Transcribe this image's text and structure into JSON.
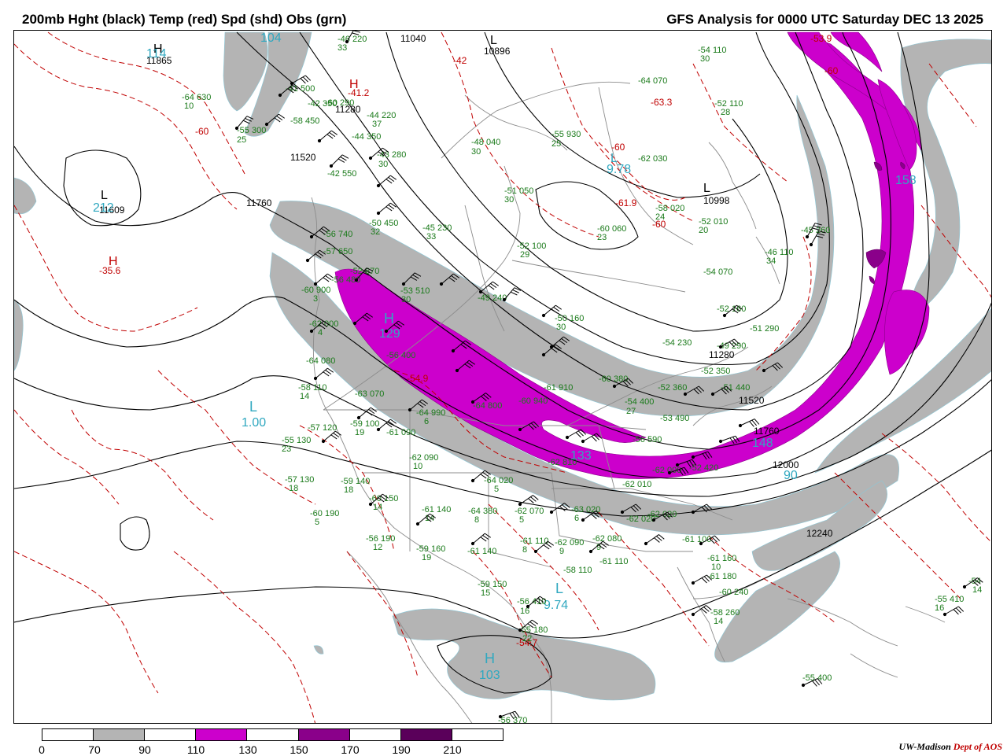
{
  "header": {
    "title_left": "200mb Hght (black) Temp (red) Spd (shd) Obs (grn)",
    "title_right": "GFS Analysis for 0000 UTC Saturday  DEC 13 2025"
  },
  "colors": {
    "height_contour": "#000000",
    "temp_contour": "#c00000",
    "obs_text": "#1a7a1a",
    "speed_label": "#30a8c0",
    "geography": "#8c8c8c",
    "speed_70_90": "#b4b4b4",
    "speed_110_130": "#cc00cc",
    "speed_150_170": "#8a008a",
    "speed_190_210": "#5a005a"
  },
  "colorbar": {
    "labels": [
      "0",
      "70",
      "90",
      "110",
      "130",
      "150",
      "170",
      "190",
      "210"
    ],
    "segments": [
      "#ffffff",
      "#b4b4b4",
      "#ffffff",
      "#cc00cc",
      "#ffffff",
      "#8a008a",
      "#ffffff",
      "#5a005a",
      "#ffffff"
    ]
  },
  "credit": {
    "org": "UW-Madison",
    "dept": "Dept of AOS"
  },
  "height_labels": [
    {
      "text": "11040"
    },
    {
      "text": "10896"
    },
    {
      "text": "11280"
    },
    {
      "text": "11520"
    },
    {
      "text": "11760"
    },
    {
      "text": "11609"
    },
    {
      "text": "11865"
    },
    {
      "text": "10998"
    },
    {
      "text": "11520"
    },
    {
      "text": "11760"
    },
    {
      "text": "12000"
    },
    {
      "text": "12240"
    },
    {
      "text": "11280"
    }
  ],
  "temp_labels": [
    {
      "text": "-41.2"
    },
    {
      "text": "-42"
    },
    {
      "text": "-60"
    },
    {
      "text": "-35.6"
    },
    {
      "text": "-54.9"
    },
    {
      "text": "-61.9"
    },
    {
      "text": "-63.3"
    },
    {
      "text": "-60"
    },
    {
      "text": "-54.7"
    },
    {
      "text": "-53.9"
    },
    {
      "text": "-60"
    },
    {
      "text": "-60"
    }
  ],
  "hl_markers": [
    {
      "text": "H"
    },
    {
      "text": "L"
    },
    {
      "text": "H"
    },
    {
      "text": "H"
    },
    {
      "text": "L"
    },
    {
      "text": "L"
    },
    {
      "text": "H"
    },
    {
      "text": "L"
    },
    {
      "text": "L"
    },
    {
      "text": "L"
    },
    {
      "text": "H"
    }
  ],
  "speed_labels": [
    {
      "text": "104"
    },
    {
      "text": "114"
    },
    {
      "text": "129"
    },
    {
      "text": "1.00"
    },
    {
      "text": "9.78"
    },
    {
      "text": "158"
    },
    {
      "text": "133"
    },
    {
      "text": "148"
    },
    {
      "text": "90"
    },
    {
      "text": "9.74"
    },
    {
      "text": "103"
    },
    {
      "text": "212"
    }
  ],
  "obs": [
    {
      "text": "-46 220"
    },
    {
      "text": "33"
    },
    {
      "text": "-64 630"
    },
    {
      "text": "10"
    },
    {
      "text": "-55 300"
    },
    {
      "text": "25"
    },
    {
      "text": "-42 350"
    },
    {
      "text": "-44 220"
    },
    {
      "text": "37"
    },
    {
      "text": "-41 500"
    },
    {
      "text": "-48 040"
    },
    {
      "text": "30"
    },
    {
      "text": "-55 930"
    },
    {
      "text": "25"
    },
    {
      "text": "-64 070"
    },
    {
      "text": "-54 110"
    },
    {
      "text": "30"
    },
    {
      "text": "-52 110"
    },
    {
      "text": "28"
    },
    {
      "text": "-62 030"
    },
    {
      "text": "-52 010"
    },
    {
      "text": "20"
    },
    {
      "text": "-58 020"
    },
    {
      "text": "24"
    },
    {
      "text": "-60 060"
    },
    {
      "text": "23"
    },
    {
      "text": "-51 050"
    },
    {
      "text": "30"
    },
    {
      "text": "-52 100"
    },
    {
      "text": "29"
    },
    {
      "text": "-45 230"
    },
    {
      "text": "33"
    },
    {
      "text": "-50 450"
    },
    {
      "text": "32"
    },
    {
      "text": "-43 280"
    },
    {
      "text": "30"
    },
    {
      "text": "-52 670"
    },
    {
      "text": "-53 510"
    },
    {
      "text": "30"
    },
    {
      "text": "-49 240"
    },
    {
      "text": "-50 160"
    },
    {
      "text": "30"
    },
    {
      "text": "-54 230"
    },
    {
      "text": "-54 070"
    },
    {
      "text": "-46 110"
    },
    {
      "text": "34"
    },
    {
      "text": "-45 260"
    },
    {
      "text": "-52 160"
    },
    {
      "text": "-51 290"
    },
    {
      "text": "-49 290"
    },
    {
      "text": "-52 350"
    },
    {
      "text": "-52 360"
    },
    {
      "text": "-51 440"
    },
    {
      "text": "-54 400"
    },
    {
      "text": "27"
    },
    {
      "text": "-53 490"
    },
    {
      "text": "-56 590"
    },
    {
      "text": "-52 420"
    },
    {
      "text": "-60 900"
    },
    {
      "text": "3"
    },
    {
      "text": "-62 000"
    },
    {
      "text": "4"
    },
    {
      "text": "-64 080"
    },
    {
      "text": "-58 110"
    },
    {
      "text": "14"
    },
    {
      "text": "-63 070"
    },
    {
      "text": "-64 990"
    },
    {
      "text": "6"
    },
    {
      "text": "-55 130"
    },
    {
      "text": "23"
    },
    {
      "text": "-57 120"
    },
    {
      "text": "-59 100"
    },
    {
      "text": "19"
    },
    {
      "text": "-61 090"
    },
    {
      "text": "-62 090"
    },
    {
      "text": "10"
    },
    {
      "text": "-64 020"
    },
    {
      "text": "5"
    },
    {
      "text": "-57 130"
    },
    {
      "text": "18"
    },
    {
      "text": "-59 140"
    },
    {
      "text": "18"
    },
    {
      "text": "-60 150"
    },
    {
      "text": "14"
    },
    {
      "text": "-60 190"
    },
    {
      "text": "5"
    },
    {
      "text": "-61 140"
    },
    {
      "text": "14"
    },
    {
      "text": "-64 380"
    },
    {
      "text": "8"
    },
    {
      "text": "-62 070"
    },
    {
      "text": "5"
    },
    {
      "text": "-63 020"
    },
    {
      "text": "6"
    },
    {
      "text": "-62 020"
    },
    {
      "text": "-62 020"
    },
    {
      "text": "-61 110"
    },
    {
      "text": "8"
    },
    {
      "text": "-62 090"
    },
    {
      "text": "9"
    },
    {
      "text": "-62 080"
    },
    {
      "text": "9"
    },
    {
      "text": "-61 100"
    },
    {
      "text": "-56 190"
    },
    {
      "text": "12"
    },
    {
      "text": "-59 160"
    },
    {
      "text": "19"
    },
    {
      "text": "-61 140"
    },
    {
      "text": "-58 110"
    },
    {
      "text": "-61 110"
    },
    {
      "text": "-61 160"
    },
    {
      "text": "10"
    },
    {
      "text": "-61 180"
    },
    {
      "text": "-60 240"
    },
    {
      "text": "-59 150"
    },
    {
      "text": "15"
    },
    {
      "text": "-56 410"
    },
    {
      "text": "16"
    },
    {
      "text": "-58 260"
    },
    {
      "text": "14"
    },
    {
      "text": "-55 180"
    },
    {
      "text": "22"
    },
    {
      "text": "-55 410"
    },
    {
      "text": "16"
    },
    {
      "text": "-54"
    },
    {
      "text": "14"
    },
    {
      "text": "-55 400"
    },
    {
      "text": "-56 370"
    },
    {
      "text": "-60 940"
    },
    {
      "text": "-62 810"
    },
    {
      "text": "-62 010"
    },
    {
      "text": "-62 000"
    },
    {
      "text": "-64 800"
    },
    {
      "text": "-56 740"
    },
    {
      "text": "-57 650"
    },
    {
      "text": "-56 480"
    },
    {
      "text": "-61 910"
    },
    {
      "text": "-60 380"
    },
    {
      "text": "-56 400"
    },
    {
      "text": "-60 290"
    },
    {
      "text": "-58 450"
    },
    {
      "text": "-44 350"
    },
    {
      "text": "-42 550"
    },
    {
      "text": "-51 970"
    },
    {
      "text": "-62 490"
    }
  ]
}
